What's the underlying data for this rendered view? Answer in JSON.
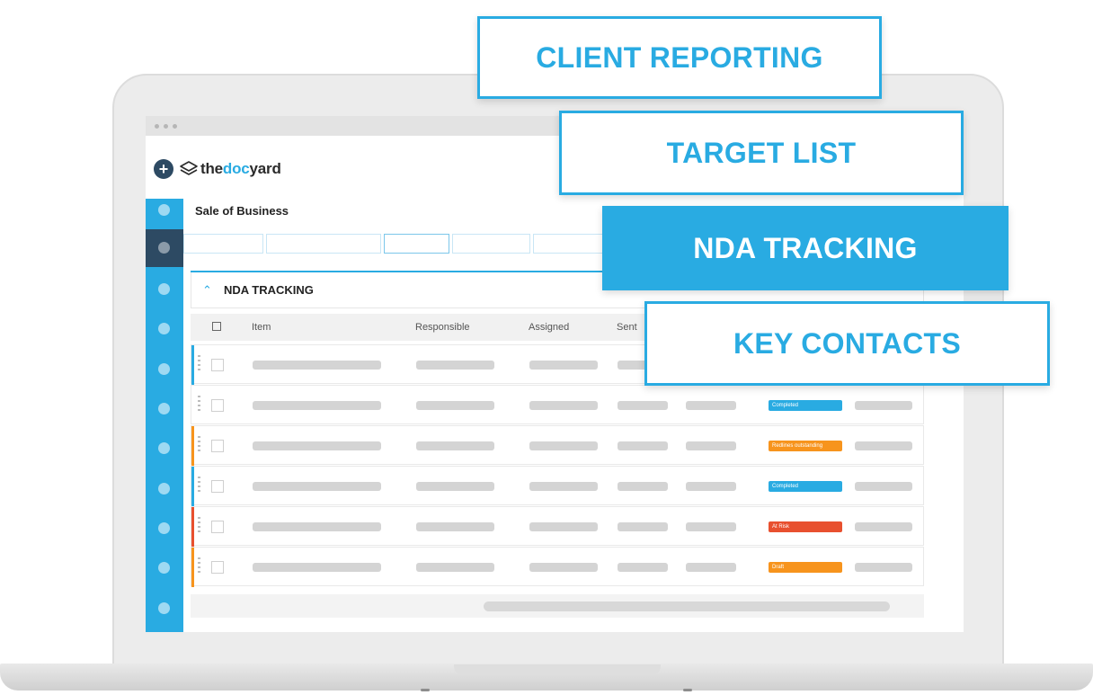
{
  "app": {
    "brand_prefix": "the",
    "brand_accent": "doc",
    "brand_suffix": "yard",
    "page_title": "Sale of Business",
    "section_title": "NDA TRACKING"
  },
  "table": {
    "headers": [
      "Item",
      "Responsible",
      "Assigned",
      "Sent"
    ],
    "rows": [
      {
        "status_color": "#29abe2",
        "badge": "",
        "badge_color": ""
      },
      {
        "status_color": "",
        "badge": "Completed",
        "badge_color": "#29abe2"
      },
      {
        "status_color": "#f7941d",
        "badge": "Redlines outstanding",
        "badge_color": "#f7941d"
      },
      {
        "status_color": "#29abe2",
        "badge": "Completed",
        "badge_color": "#29abe2"
      },
      {
        "status_color": "#e8502f",
        "badge": "At Risk",
        "badge_color": "#e8502f"
      },
      {
        "status_color": "#f7941d",
        "badge": "Draft",
        "badge_color": "#f7941d"
      }
    ]
  },
  "callouts": {
    "client_reporting": "CLIENT REPORTING",
    "target_list": "TARGET LIST",
    "nda_tracking": "NDA TRACKING",
    "key_contacts": "KEY CONTACTS"
  },
  "colors": {
    "accent": "#29abe2",
    "nav_dark": "#2d4a63",
    "orange": "#f7941d",
    "red": "#e8502f"
  },
  "icons": [
    "plus-icon",
    "layers-icon",
    "chevron-up-icon",
    "checkbox-icon",
    "drag-handle-icon"
  ]
}
